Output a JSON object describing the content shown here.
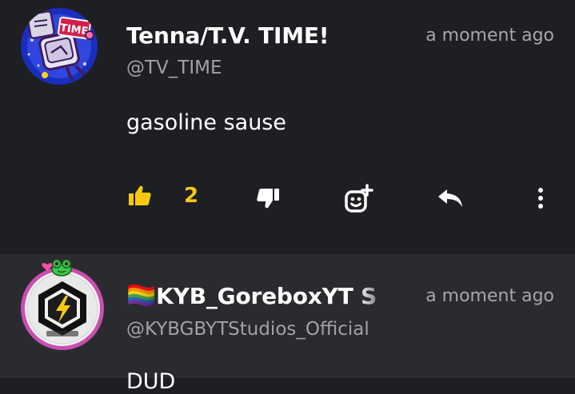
{
  "comments": [
    {
      "author": "Tenna/T.V. TIME!",
      "handle": "@TV_TIME",
      "time": "a moment ago",
      "text": "gasoline sause",
      "likes": "2",
      "avatar_badge_text": "TIME",
      "icons": [
        "thumbs-up-icon",
        "thumbs-down-icon",
        "add-reaction-icon",
        "reply-icon",
        "more-icon"
      ]
    },
    {
      "author": "KYB_GoreboxYT S",
      "handle": "@KYBGBYTStudios_Official",
      "time": "a moment ago",
      "text": "DUD",
      "flag": "🏳️‍🌈"
    }
  ],
  "colors": {
    "background": "#1e1f22",
    "second_comment_bg": "#2a2b2e",
    "accent": "#f6c90e",
    "muted_text": "#a7a7ab"
  }
}
